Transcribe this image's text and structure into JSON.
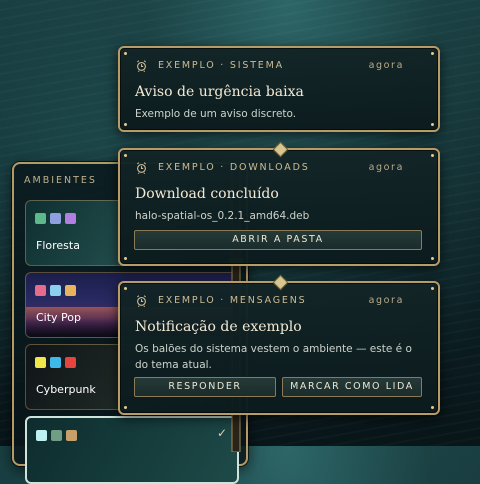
{
  "panel": {
    "title": "AMBIENTES",
    "themes": [
      {
        "name": "Floresta",
        "swatches": [
          "#5db88c",
          "#8ea0e0",
          "#b07fe0"
        ]
      },
      {
        "name": "City Pop",
        "swatches": [
          "#e66b8c",
          "#8ad0ef",
          "#e7b35c"
        ]
      },
      {
        "name": "Cyberpunk",
        "swatches": [
          "#f0e84a",
          "#3fb8ea",
          "#e6443f"
        ]
      },
      {
        "name": "",
        "swatches": [
          "#bff0f2",
          "#6f9e84",
          "#c8a06a"
        ],
        "selected": true
      }
    ]
  },
  "notifications": [
    {
      "app": "EXEMPLO · SISTEMA",
      "time": "agora",
      "title": "Aviso de urgência baixa",
      "body": "Exemplo de um aviso discreto.",
      "actions": []
    },
    {
      "app": "EXEMPLO · DOWNLOADS",
      "time": "agora",
      "title": "Download concluído",
      "body": "halo-spatial-os_0.2.1_amd64.deb",
      "actions": [
        "ABRIR A PASTA"
      ]
    },
    {
      "app": "EXEMPLO · MENSAGENS",
      "time": "agora",
      "title": "Notificação de exemplo",
      "body": "Os balões do sistema vestem o ambiente — este é o do tema atual.",
      "actions": [
        "RESPONDER",
        "MARCAR COMO LIDA"
      ]
    }
  ],
  "icons": {
    "notification": "bell-icon",
    "selected": "checkmark-icon"
  },
  "colors": {
    "accent": "#b89c68",
    "background": "#0d2226"
  }
}
